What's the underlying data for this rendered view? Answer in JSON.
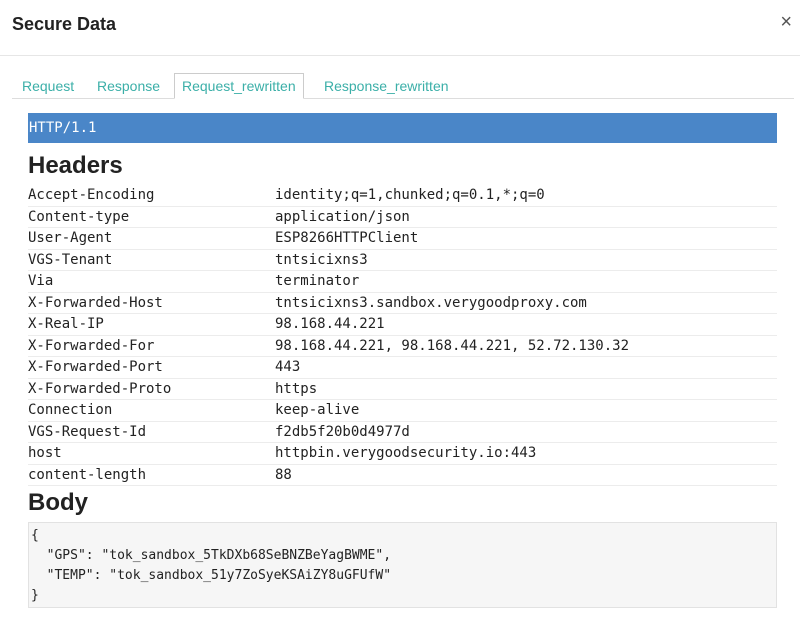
{
  "modal": {
    "title": "Secure Data",
    "close_symbol": "×"
  },
  "tabs": [
    {
      "label": "Request",
      "active": false
    },
    {
      "label": "Response",
      "active": false
    },
    {
      "label": "Request_rewritten",
      "active": true
    },
    {
      "label": "Response_rewritten",
      "active": false
    }
  ],
  "protocol": "HTTP/1.1",
  "headers_title": "Headers",
  "headers": [
    {
      "name": "Accept-Encoding",
      "value": "identity;q=1,chunked;q=0.1,*;q=0"
    },
    {
      "name": "Content-type",
      "value": "application/json"
    },
    {
      "name": "User-Agent",
      "value": "ESP8266HTTPClient"
    },
    {
      "name": "VGS-Tenant",
      "value": "tntsicixns3"
    },
    {
      "name": "Via",
      "value": "terminator"
    },
    {
      "name": "X-Forwarded-Host",
      "value": "tntsicixns3.sandbox.verygoodproxy.com"
    },
    {
      "name": "X-Real-IP",
      "value": "98.168.44.221"
    },
    {
      "name": "X-Forwarded-For",
      "value": "98.168.44.221, 98.168.44.221, 52.72.130.32"
    },
    {
      "name": "X-Forwarded-Port",
      "value": "443"
    },
    {
      "name": "X-Forwarded-Proto",
      "value": "https"
    },
    {
      "name": "Connection",
      "value": "keep-alive"
    },
    {
      "name": "VGS-Request-Id",
      "value": "f2db5f20b0d4977d"
    },
    {
      "name": "host",
      "value": "httpbin.verygoodsecurity.io:443"
    },
    {
      "name": "content-length",
      "value": "88"
    }
  ],
  "body_title": "Body",
  "body_text": "{\n  \"GPS\": \"tok_sandbox_5TkDXb68SeBNZBeYagBWME\",\n  \"TEMP\": \"tok_sandbox_51y7ZoSyeKSAiZY8uGFUfW\"\n}",
  "colors": {
    "accent": "#3bafa8",
    "protocol_bar": "#4a86c8"
  }
}
